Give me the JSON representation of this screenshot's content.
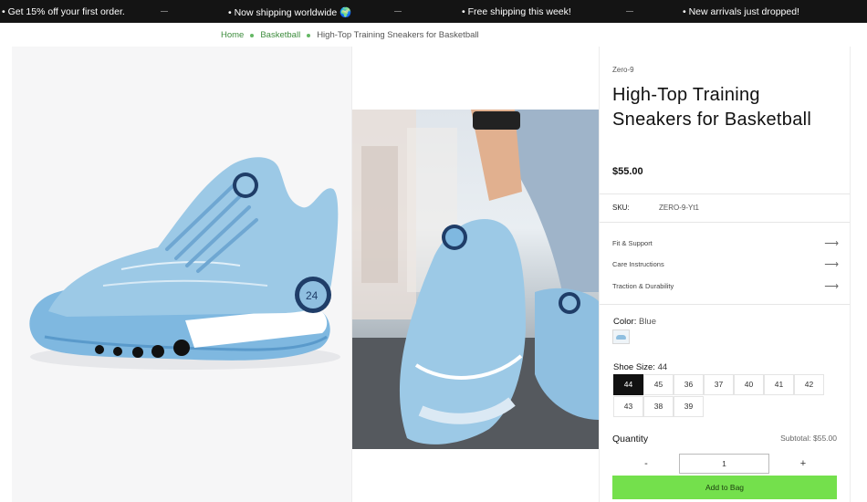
{
  "announcement": {
    "messages": [
      "• Get 15% off your first order.",
      "• Now shipping worldwide 🌍",
      "• Free shipping this week!",
      "• New arrivals just dropped!"
    ]
  },
  "breadcrumb": {
    "home": "Home",
    "category": "Basketball",
    "current": "High-Top Training Sneakers for Basketball"
  },
  "product": {
    "brand": "Zero-9",
    "title": "High-Top Training Sneakers for Basketball",
    "price": "$55.00",
    "sku_label": "SKU:",
    "sku_value": "ZERO-9-Yt1",
    "accordions": [
      "Fit & Support",
      "Care Instructions",
      "Traction & Durability"
    ],
    "color_label": "Color:",
    "color_value": "Blue",
    "size_label": "Shoe Size:",
    "size_value": "44",
    "sizes": [
      "44",
      "45",
      "36",
      "37",
      "40",
      "41",
      "42",
      "43",
      "38",
      "39"
    ],
    "selected_size": "44",
    "quantity_label": "Quantity",
    "subtotal": "Subtotal: $55.00",
    "qty_minus": "-",
    "qty_value": "1",
    "qty_plus": "+",
    "add_to_bag": "Add to Bag"
  },
  "icons": {
    "accordion_arrow": "arrow-right-icon"
  },
  "colors": {
    "accent_green": "#3d8c3d",
    "button_green": "#74e04c",
    "announcement_bg": "#141414",
    "shoe_blue": "#9cc9e6"
  }
}
